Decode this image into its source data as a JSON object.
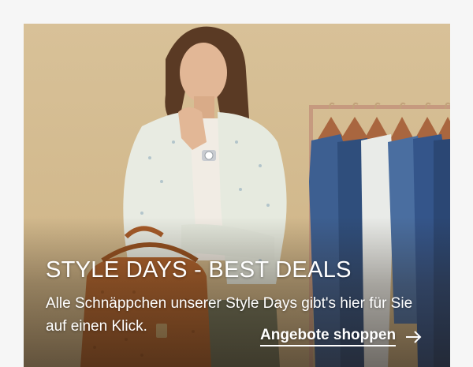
{
  "teaser": {
    "headline": "STYLE DAYS - BEST DEALS",
    "subline": "Alle Schnäppchen unserer Style Days gibt's hier für Sie auf einen Klick.",
    "cta_label": "Angebote shoppen",
    "cta_icon": "arrow-right-icon",
    "colors": {
      "background": "#d2b98d",
      "text": "#ffffff",
      "jacket": "#e9ece4",
      "bag": "#b0622b",
      "denim": "#3e5f8f",
      "rack": "#c69a7f"
    }
  }
}
